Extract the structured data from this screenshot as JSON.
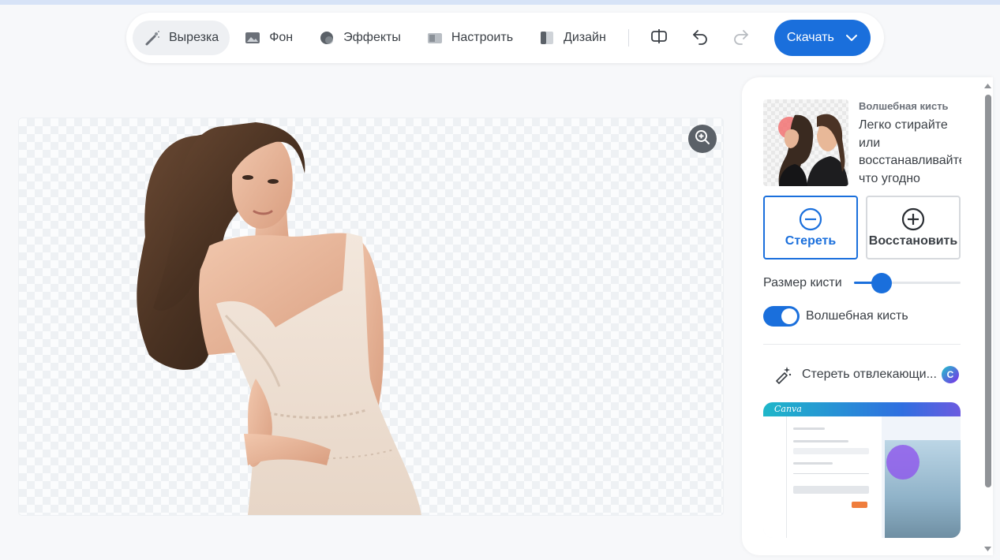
{
  "toolbar": {
    "tabs": [
      {
        "label": "Вырезка",
        "icon": "cutout-wand-icon",
        "active": true
      },
      {
        "label": "Фон",
        "icon": "background-image-icon",
        "active": false
      },
      {
        "label": "Эффекты",
        "icon": "effects-circle-icon",
        "active": false
      },
      {
        "label": "Настроить",
        "icon": "adjust-icon",
        "active": false
      },
      {
        "label": "Дизайн",
        "icon": "design-icon",
        "active": false
      }
    ],
    "actions": [
      "compare-icon",
      "undo-icon",
      "redo-icon"
    ],
    "download_label": "Скачать"
  },
  "panel": {
    "promo_title": "Волшебная кисть",
    "promo_desc": "Легко стирайте или восстанавливайте что угодно",
    "erase_label": "Стереть",
    "restore_label": "Восстановить",
    "brush_size_label": "Размер кисти",
    "brush_size_value": 0.26,
    "magic_brush_label": "Волшебная кисть",
    "magic_brush_enabled": true,
    "erase_distractions_label": "Стереть отвлекающи...",
    "video_logo": "Canva"
  },
  "colors": {
    "accent": "#1a6fdc",
    "toolbar_active_bg": "#eef0f3"
  }
}
